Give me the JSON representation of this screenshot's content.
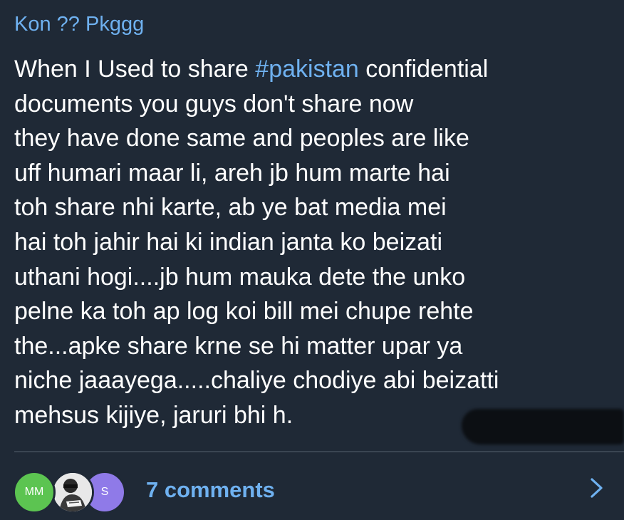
{
  "post": {
    "author": "Kon ?? Pkggg",
    "message_lines": [
      {
        "pre": "When I Used to share ",
        "tag": "#pakistan",
        "post": " confidential"
      },
      {
        "text": "documents you guys don't share now"
      },
      {
        "text": "they have done same and peoples are like"
      },
      {
        "text": "uff humari maar li, areh jb hum marte hai"
      },
      {
        "text": "toh share nhi karte, ab ye bat media mei"
      },
      {
        "text": "hai toh jahir hai ki indian janta ko beizati"
      },
      {
        "text": "uthani hogi....jb hum mauka dete the unko"
      },
      {
        "text": "pelne ka toh ap log koi bill mei chupe rehte"
      },
      {
        "text": "the...apke share krne se hi matter upar ya"
      },
      {
        "text": "niche jaaayega.....chaliye chodiye abi beizatti"
      },
      {
        "text": "mehsus kijiye, jaruri bhi h."
      }
    ]
  },
  "footer": {
    "avatars": [
      {
        "initials": "MM",
        "color": "#5cc451"
      },
      {
        "icon": "photo-avatar"
      },
      {
        "initials": "S",
        "color": "#8f7ae8"
      }
    ],
    "comments_label": "7 comments",
    "chevron_icon": "chevron-right-icon"
  },
  "colors": {
    "background": "#1f2936",
    "accent": "#6fb1f0",
    "text": "#ffffff",
    "divider": "#3a4552"
  }
}
